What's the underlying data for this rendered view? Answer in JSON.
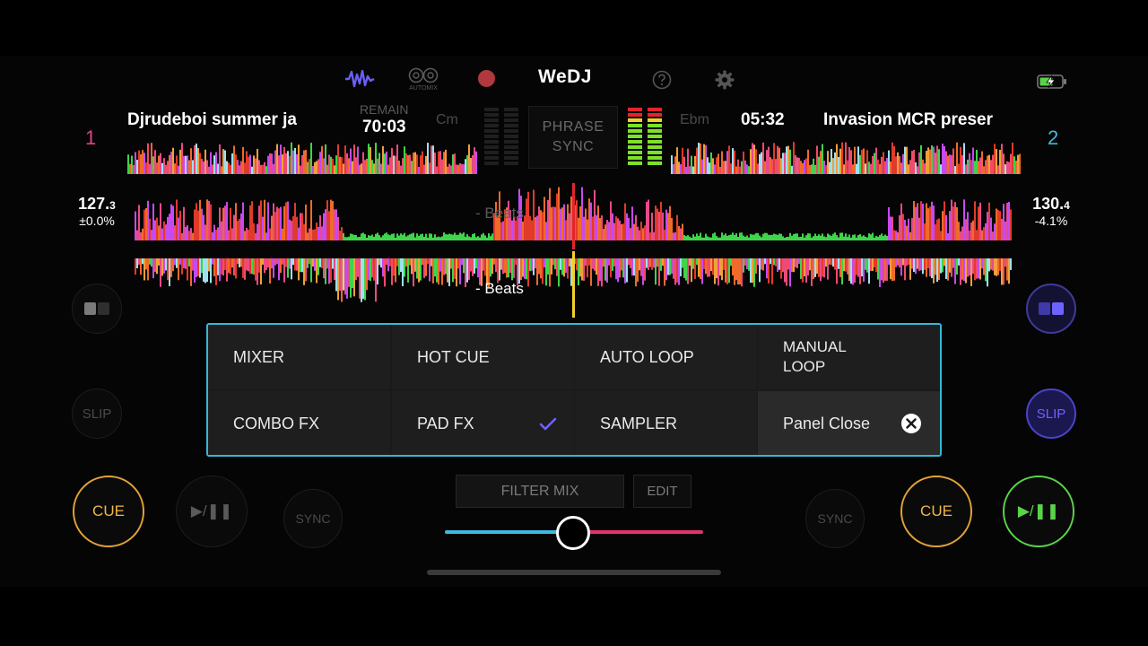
{
  "topbar": {
    "logo": "WeDJ",
    "automix_label": "AUTOMIX",
    "icons": [
      "waveform-icon",
      "automix-icon",
      "record-icon",
      "help-icon",
      "gear-icon",
      "battery-charging-icon"
    ]
  },
  "deck1": {
    "number": "1",
    "title": "Djrudeboi summer ja",
    "remain_label": "REMAIN",
    "time": "70:03",
    "key": "Cm",
    "bpm_int": "127.",
    "bpm_dec": "3",
    "pitch": "±0.0%",
    "beats_label": "- Beats",
    "cue_label": "CUE",
    "play_label": "▶/❚❚",
    "sync_label": "SYNC",
    "slip_label": "SLIP"
  },
  "deck2": {
    "number": "2",
    "title": "Invasion MCR preser",
    "time": "05:32",
    "key": "Ebm",
    "bpm_int": "130.",
    "bpm_dec": "4",
    "pitch": "-4.1%",
    "beats_label": "- Beats",
    "cue_label": "CUE",
    "play_label": "▶/❚❚",
    "sync_label": "SYNC",
    "slip_label": "SLIP"
  },
  "phrase_sync": {
    "line1": "PHRASE",
    "line2": "SYNC"
  },
  "panel": {
    "mixer": "MIXER",
    "hot_cue": "HOT CUE",
    "auto_loop": "AUTO LOOP",
    "manual_loop_1": "MANUAL",
    "manual_loop_2": "LOOP",
    "combo_fx": "COMBO FX",
    "pad_fx": "PAD FX",
    "sampler": "SAMPLER",
    "panel_close": "Panel Close"
  },
  "mixer": {
    "filter_mix": "FILTER MIX",
    "edit": "EDIT",
    "crossfader_position": 0.5
  },
  "colors": {
    "deck1": "#e4418a",
    "deck2": "#3fb8df",
    "cue": "#e0a23a",
    "play_active": "#5ad34a",
    "slip_active": "#4a44c8",
    "panel_border": "#35b8d6"
  }
}
